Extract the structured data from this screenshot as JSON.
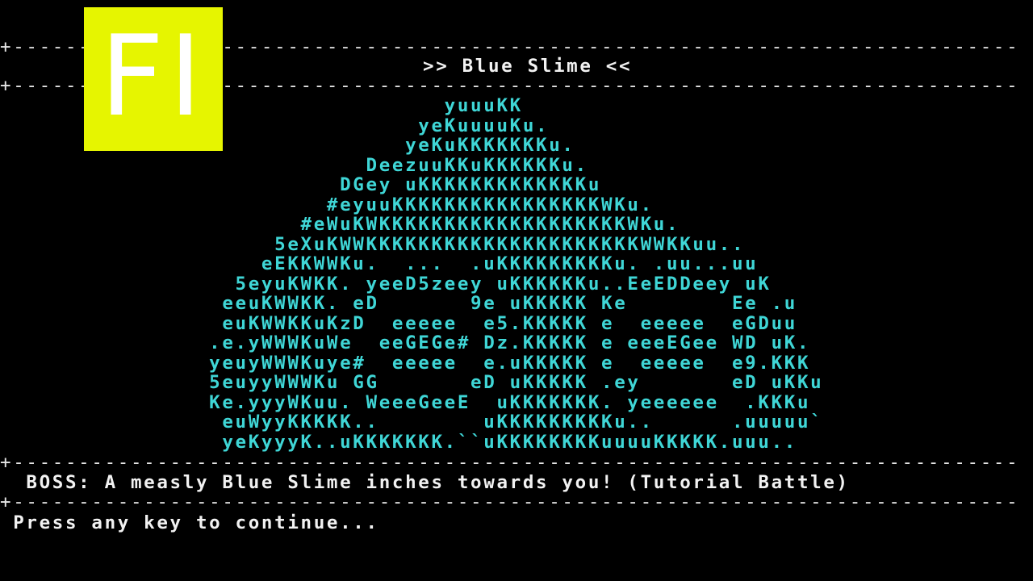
{
  "logo": {
    "text": "FI",
    "background": "#e6f500"
  },
  "borders": {
    "top": "+-----------------------------------------------------------------------------",
    "under_title": "+-----------------------------------------------------------------------------",
    "above_message": "+-----------------------------------------------------------------------------",
    "below_message": "+-----------------------------------------------------------------------------"
  },
  "title": ">> Blue Slime <<",
  "art_color": "#3fd6d6",
  "art": [
    "                                  yuuuKK",
    "                                yeKuuuuKu.",
    "                               yeKuKKKKKKKu.",
    "                            DeezuuKKuKKKKKKu.",
    "                          DGey uKKKKKKKKKKKKKu",
    "                         #eyuuKKKKKKKKKKKKKKKKWKu.",
    "                       #eWuKWKKKKKKKKKKKKKKKKKKKWKu.",
    "                     5eXuKWWKKKKKKKKKKKKKKKKKKKKKWWKKuu..",
    "                    eEKKWWKu.  ...  .uKKKKKKKKKu. .uu...uu",
    "                  5eyuKWKK. yeeD5zeey uKKKKKKu..EeEDDeey uK",
    "                 eeuKWWKK. eD       9e uKKKKK Ke        Ee .u",
    "                 euKWWKKuKzD  eeeee  e5.KKKKK e  eeeee  eGDuu",
    "                .e.yWWWKuWe  eeGEGe# Dz.KKKKK e eeeEGee WD uK.",
    "                yeuyWWWKuye#  eeeee  e.uKKKKK e  eeeee  e9.KKK",
    "                5euyyWWWKu GG       eD uKKKKK .ey       eD uKKu",
    "                Ke.yyyWKuu. WeeeGeeE  uKKKKKKK. yeeeeee  .KKKu",
    "                 euWyyKKKKK..        uKKKKKKKKKu..      .uuuuu`",
    "                 yeKyyyK..uKKKKKKK.``uKKKKKKKKuuuuKKKKK.uuu.."
  ],
  "message": "  BOSS: A measly Blue Slime inches towards you! (Tutorial Battle)",
  "prompt": " Press any key to continue..."
}
